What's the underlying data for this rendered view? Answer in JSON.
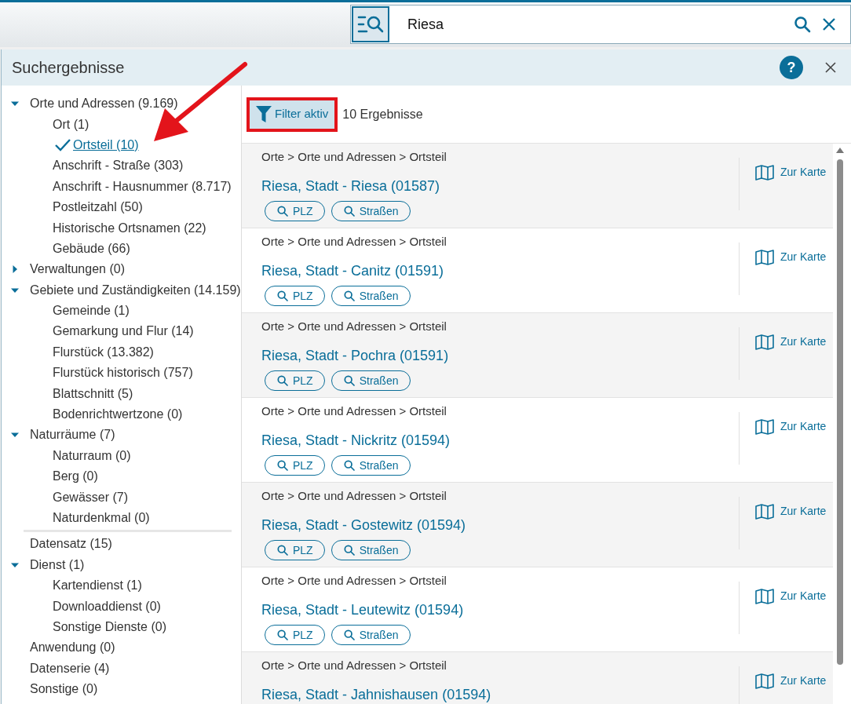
{
  "search": {
    "value": "Riesa"
  },
  "panel": {
    "title": "Suchergebnisse",
    "help": "?"
  },
  "filter": {
    "label": "Filter aktiv",
    "active": true,
    "count": "10 Ergebnisse"
  },
  "tree": [
    {
      "label": "Orte und Adressen (9.169)",
      "expanded": true,
      "children": [
        {
          "label": "Ort (1)",
          "selected": false
        },
        {
          "label": "Ortsteil (10)",
          "selected": true
        },
        {
          "label": "Anschrift - Straße (303)",
          "selected": false
        },
        {
          "label": "Anschrift - Hausnummer (8.717)",
          "selected": false
        },
        {
          "label": "Postleitzahl (50)",
          "selected": false
        },
        {
          "label": "Historische Ortsnamen (22)",
          "selected": false
        },
        {
          "label": "Gebäude (66)",
          "selected": false
        }
      ]
    },
    {
      "label": "Verwaltungen (0)",
      "expanded": false
    },
    {
      "label": "Gebiete und Zuständigkeiten (14.159)",
      "expanded": true,
      "children": [
        {
          "label": "Gemeinde (1)",
          "selected": false
        },
        {
          "label": "Gemarkung und Flur (14)",
          "selected": false
        },
        {
          "label": "Flurstück (13.382)",
          "selected": false
        },
        {
          "label": "Flurstück historisch (757)",
          "selected": false
        },
        {
          "label": "Blattschnitt (5)",
          "selected": false
        },
        {
          "label": "Bodenrichtwertzone (0)",
          "selected": false
        }
      ]
    },
    {
      "label": "Naturräume (7)",
      "expanded": true,
      "children": [
        {
          "label": "Naturraum (0)",
          "selected": false
        },
        {
          "label": "Berg (0)",
          "selected": false
        },
        {
          "label": "Gewässer (7)",
          "selected": false
        },
        {
          "label": "Naturdenkmal (0)",
          "selected": false
        }
      ]
    },
    {
      "label": "Datensatz (15)",
      "divider_before": true
    },
    {
      "label": "Dienst (1)",
      "expanded": true,
      "children": [
        {
          "label": "Kartendienst (1)",
          "selected": false
        },
        {
          "label": "Downloaddienst (0)",
          "selected": false
        },
        {
          "label": "Sonstige Dienste (0)",
          "selected": false
        }
      ]
    },
    {
      "label": "Anwendung (0)"
    },
    {
      "label": "Datenserie (4)"
    },
    {
      "label": "Sonstige (0)"
    }
  ],
  "results": [
    {
      "path": "Orte > Orte und Adressen > Ortsteil",
      "title": "Riesa, Stadt - Riesa (01587)",
      "actions": [
        "PLZ",
        "Straßen"
      ],
      "map": "Zur Karte"
    },
    {
      "path": "Orte > Orte und Adressen > Ortsteil",
      "title": "Riesa, Stadt - Canitz (01591)",
      "actions": [
        "PLZ",
        "Straßen"
      ],
      "map": "Zur Karte"
    },
    {
      "path": "Orte > Orte und Adressen > Ortsteil",
      "title": "Riesa, Stadt - Pochra (01591)",
      "actions": [
        "PLZ",
        "Straßen"
      ],
      "map": "Zur Karte"
    },
    {
      "path": "Orte > Orte und Adressen > Ortsteil",
      "title": "Riesa, Stadt - Nickritz (01594)",
      "actions": [
        "PLZ",
        "Straßen"
      ],
      "map": "Zur Karte"
    },
    {
      "path": "Orte > Orte und Adressen > Ortsteil",
      "title": "Riesa, Stadt - Gostewitz (01594)",
      "actions": [
        "PLZ",
        "Straßen"
      ],
      "map": "Zur Karte"
    },
    {
      "path": "Orte > Orte und Adressen > Ortsteil",
      "title": "Riesa, Stadt - Leutewitz (01594)",
      "actions": [
        "PLZ",
        "Straßen"
      ],
      "map": "Zur Karte"
    },
    {
      "path": "Orte > Orte und Adressen > Ortsteil",
      "title": "Riesa, Stadt - Jahnishausen (01594)",
      "map": "Zur Karte"
    }
  ]
}
